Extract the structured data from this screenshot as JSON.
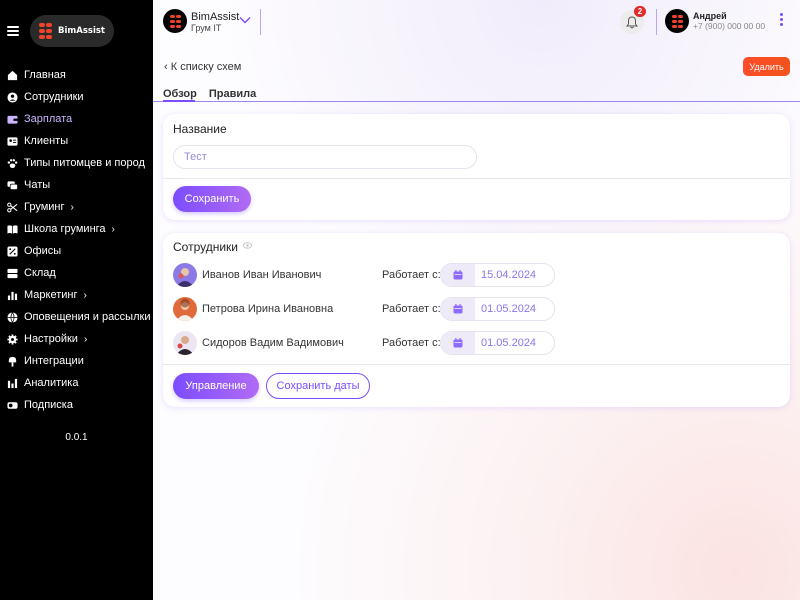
{
  "sidebar": {
    "brand": "BimAssist",
    "items": [
      {
        "label": "Главная",
        "icon": "home-icon",
        "chevron": ""
      },
      {
        "label": "Сотрудники",
        "icon": "user-circle-icon",
        "chevron": ""
      },
      {
        "label": "Зарплата",
        "icon": "wallet-icon",
        "chevron": "",
        "active": true
      },
      {
        "label": "Клиенты",
        "icon": "id-card-icon",
        "chevron": ""
      },
      {
        "label": "Типы питомцев и пород",
        "icon": "paw-icon",
        "chevron": ""
      },
      {
        "label": "Чаты",
        "icon": "chat-icon",
        "chevron": ""
      },
      {
        "label": "Груминг",
        "icon": "scissors-icon",
        "chevron": "›"
      },
      {
        "label": "Школа груминга",
        "icon": "book-icon",
        "chevron": "›"
      },
      {
        "label": "Офисы",
        "icon": "office-icon",
        "chevron": ""
      },
      {
        "label": "Склад",
        "icon": "warehouse-icon",
        "chevron": ""
      },
      {
        "label": "Маркетинг",
        "icon": "bar-chart-icon",
        "chevron": "›"
      },
      {
        "label": "Оповещения и рассылки",
        "icon": "globe-icon",
        "chevron": ""
      },
      {
        "label": "Настройки",
        "icon": "gear-icon",
        "chevron": "›"
      },
      {
        "label": "Интеграции",
        "icon": "plug-icon",
        "chevron": ""
      },
      {
        "label": "Аналитика",
        "icon": "analytics-icon",
        "chevron": ""
      },
      {
        "label": "Подписка",
        "icon": "toggle-icon",
        "chevron": ""
      }
    ],
    "version": "0.0.1"
  },
  "topbar": {
    "org_name": "BimAssist",
    "org_sub": "Грум IT",
    "notifications_count": "2",
    "user_name": "Андрей",
    "user_phone": "+7 (900) 000 00 00"
  },
  "page": {
    "back_label": "К списку схем",
    "delete_label": "Удалить",
    "tabs": [
      {
        "label": "Обзор",
        "active": true
      },
      {
        "label": "Правила",
        "active": false
      }
    ]
  },
  "name_card": {
    "title": "Название",
    "input_value": "Тест",
    "save_label": "Сохранить"
  },
  "employees_card": {
    "title": "Сотрудники",
    "works_since_label": "Работает с:",
    "employees": [
      {
        "name": "Иванов Иван Иванович",
        "date": "15.04.2024"
      },
      {
        "name": "Петрова Ирина Ивановна",
        "date": "01.05.2024"
      },
      {
        "name": "Сидоров Вадим Вадимович",
        "date": "01.05.2024"
      }
    ],
    "manage_label": "Управление",
    "save_dates_label": "Сохранить даты"
  },
  "colors": {
    "accent": "#7c4dff",
    "delete": "#f0541c",
    "sidebar_bg": "#000000"
  }
}
